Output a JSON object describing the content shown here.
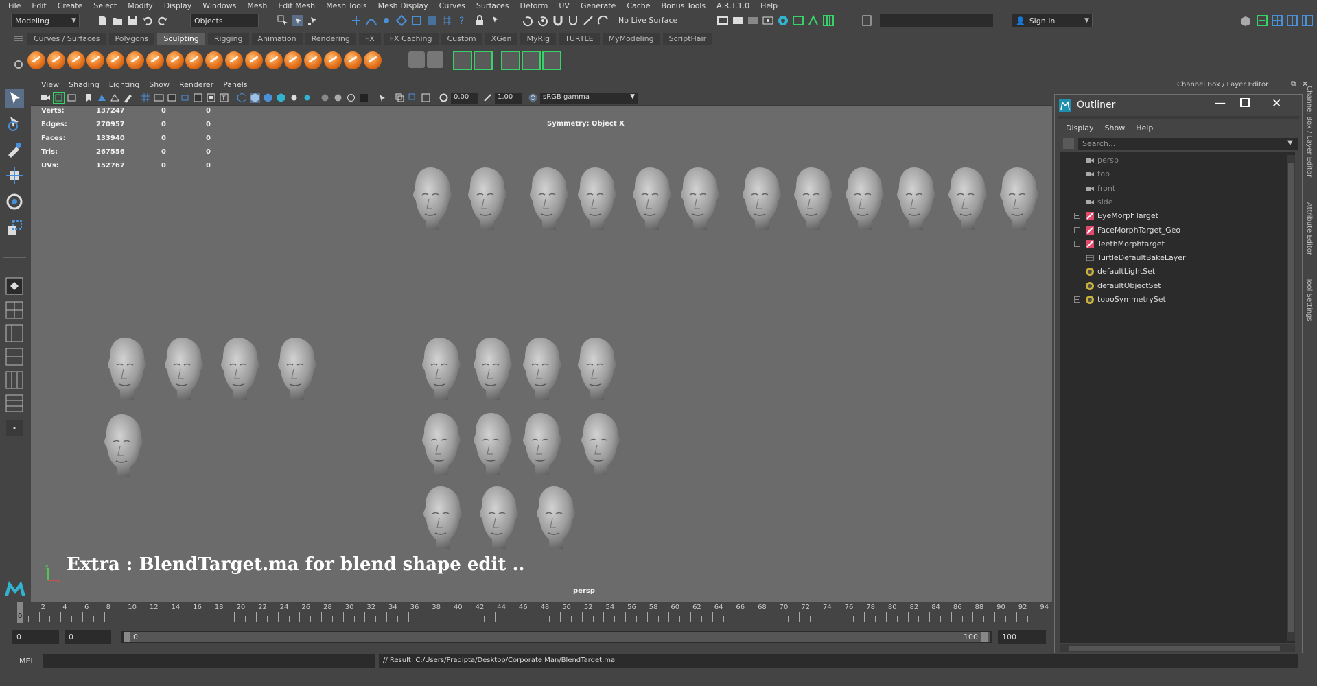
{
  "menubar": [
    "File",
    "Edit",
    "Create",
    "Select",
    "Modify",
    "Display",
    "Windows",
    "Mesh",
    "Edit Mesh",
    "Mesh Tools",
    "Mesh Display",
    "Curves",
    "Surfaces",
    "Deform",
    "UV",
    "Generate",
    "Cache",
    "Bonus Tools",
    "A.R.T.1.0",
    "Help"
  ],
  "statusline": {
    "workspace": "Modeling",
    "selection_mode": "Objects",
    "live_surface": "No Live Surface",
    "sign_in": "Sign In"
  },
  "shelf_tabs": [
    "Curves / Surfaces",
    "Polygons",
    "Sculpting",
    "Rigging",
    "Animation",
    "Rendering",
    "FX",
    "FX Caching",
    "Custom",
    "XGen",
    "MyRig",
    "TURTLE",
    "MyModeling",
    "ScriptHair"
  ],
  "shelf_active": "Sculpting",
  "panel_menu": [
    "View",
    "Shading",
    "Lighting",
    "Show",
    "Renderer",
    "Panels"
  ],
  "panel_toolbar": {
    "exposure": "0.00",
    "gamma": "1.00",
    "color_space": "sRGB gamma"
  },
  "hud": {
    "rows": [
      {
        "label": "Verts:",
        "v1": "137247",
        "v2": "0",
        "v3": "0"
      },
      {
        "label": "Edges:",
        "v1": "270957",
        "v2": "0",
        "v3": "0"
      },
      {
        "label": "Faces:",
        "v1": "133940",
        "v2": "0",
        "v3": "0"
      },
      {
        "label": "Tris:",
        "v1": "267556",
        "v2": "0",
        "v3": "0"
      },
      {
        "label": "UVs:",
        "v1": "152767",
        "v2": "0",
        "v3": "0"
      }
    ],
    "symmetry": "Symmetry: Object X",
    "camera": "persp"
  },
  "overlay_text": "Extra : BlendTarget.ma for blend shape edit ..",
  "channel_box_title": "Channel Box / Layer Editor",
  "side_tabs": [
    "Channel Box / Layer Editor",
    "Attribute Editor",
    "Tool Settings"
  ],
  "outliner": {
    "title": "Outliner",
    "menu": [
      "Display",
      "Show",
      "Help"
    ],
    "search_placeholder": "Search...",
    "items": [
      {
        "name": "persp",
        "type": "camera",
        "dim": true,
        "expand": false
      },
      {
        "name": "top",
        "type": "camera",
        "dim": true,
        "expand": false
      },
      {
        "name": "front",
        "type": "camera",
        "dim": true,
        "expand": false
      },
      {
        "name": "side",
        "type": "camera",
        "dim": true,
        "expand": false
      },
      {
        "name": "EyeMorphTarget",
        "type": "mesh",
        "dim": false,
        "expand": true
      },
      {
        "name": "FaceMorphTarget_Geo",
        "type": "mesh",
        "dim": false,
        "expand": true
      },
      {
        "name": "TeethMorphtarget",
        "type": "mesh",
        "dim": false,
        "expand": true
      },
      {
        "name": "TurtleDefaultBakeLayer",
        "type": "node",
        "dim": false,
        "expand": false
      },
      {
        "name": "defaultLightSet",
        "type": "set",
        "dim": false,
        "expand": false
      },
      {
        "name": "defaultObjectSet",
        "type": "set",
        "dim": false,
        "expand": false
      },
      {
        "name": "topoSymmetrySet",
        "type": "set",
        "dim": false,
        "expand": true
      }
    ]
  },
  "timeline": {
    "ticks": [
      "0",
      "2",
      "4",
      "6",
      "8",
      "10",
      "12",
      "14",
      "16",
      "18",
      "20",
      "22",
      "24",
      "26",
      "28",
      "30",
      "32",
      "34",
      "36",
      "38",
      "40",
      "42",
      "44",
      "46",
      "48",
      "50",
      "52",
      "54",
      "56",
      "58",
      "60",
      "62",
      "64",
      "66",
      "68",
      "70",
      "72",
      "74",
      "76",
      "78",
      "80",
      "82",
      "84",
      "86",
      "88",
      "90",
      "92",
      "94"
    ],
    "current_frame": "0",
    "range_start": "0",
    "playback_start": "0",
    "range_handle_start": "0",
    "range_handle_end": "100",
    "playback_end": "100"
  },
  "command_line": {
    "lang": "MEL",
    "result": "// Result: C:/Users/Pradipta/Desktop/Corporate Man/BlendTarget.ma"
  },
  "colors": {
    "viewport_bg": "#6b6b6b",
    "ui_bg": "#444444",
    "field_bg": "#2b2b2b",
    "shelf_orange": "#e6731d",
    "accent_green": "#37d26a"
  }
}
